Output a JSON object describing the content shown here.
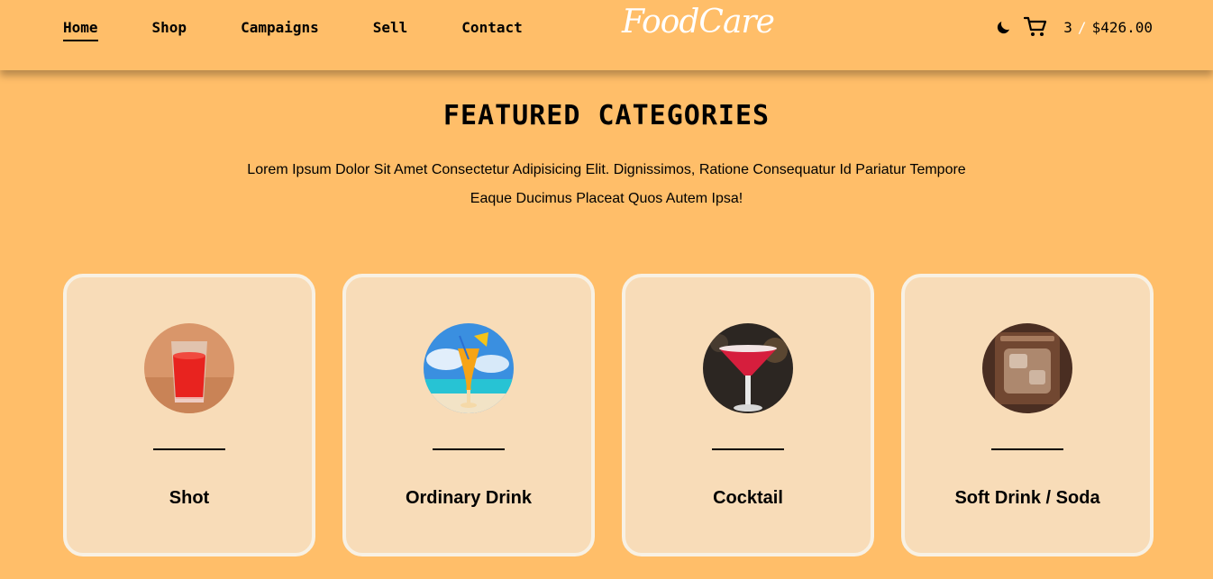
{
  "nav": {
    "items": [
      {
        "label": "Home",
        "active": true
      },
      {
        "label": "Shop"
      },
      {
        "label": "Campaigns"
      },
      {
        "label": "Sell"
      },
      {
        "label": "Contact"
      }
    ]
  },
  "brand": {
    "logo_text": "FoodCare"
  },
  "cart": {
    "count": "3",
    "separator": "/",
    "total": "$426.00"
  },
  "icons": {
    "theme_toggle": "moon-icon",
    "cart": "cart-icon"
  },
  "section": {
    "title": "FEATURED CATEGORIES",
    "description": "Lorem Ipsum Dolor Sit Amet Consectetur Adipisicing Elit. Dignissimos, Ratione Consequatur Id Pariatur Tempore Eaque Ducimus Placeat Quos Autem Ipsa!"
  },
  "categories": [
    {
      "label": "Shot"
    },
    {
      "label": "Ordinary Drink"
    },
    {
      "label": "Cocktail"
    },
    {
      "label": "Soft Drink / Soda"
    }
  ],
  "colors": {
    "background": "#ffbe69",
    "card_background": "#f8dcb8",
    "card_border": "#f8f1e4",
    "logo": "#ffffff"
  }
}
